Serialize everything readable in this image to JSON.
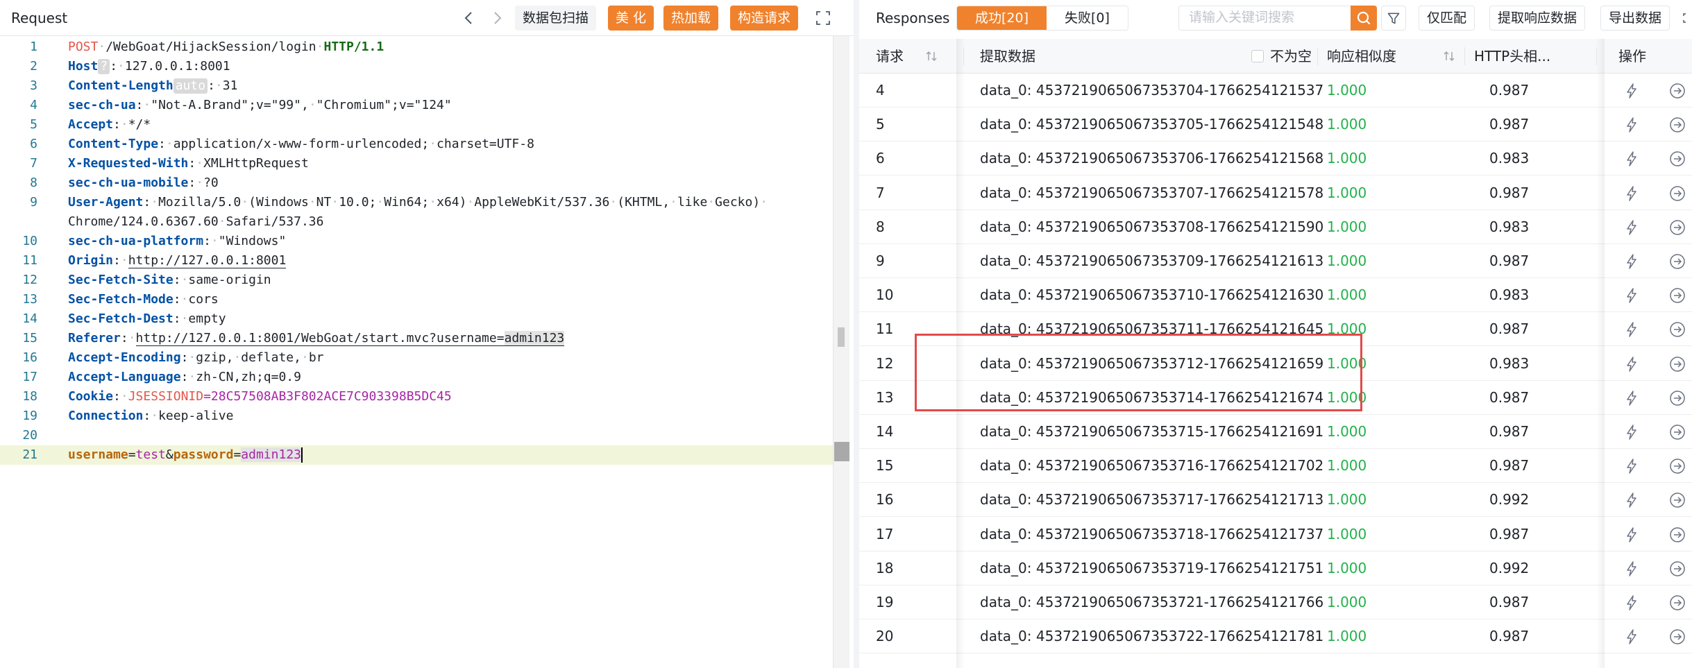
{
  "request_pane": {
    "title": "Request",
    "buttons": {
      "scan": "数据包扫描",
      "beautify": "美 化",
      "hot_load": "热加载",
      "construct": "构造请求"
    },
    "lines": [
      {
        "n": "1",
        "tokens": [
          [
            "kw-red",
            "POST"
          ],
          [
            "sep",
            "·"
          ],
          [
            "",
            "/WebGoat/HijackSession/login"
          ],
          [
            "sep",
            "·"
          ],
          [
            "kw-green",
            "HTTP/1.1"
          ]
        ]
      },
      {
        "n": "2",
        "tokens": [
          [
            "kw-blue",
            "Host"
          ],
          [
            "chip",
            "?"
          ],
          [
            "",
            ":"
          ],
          [
            "sep",
            "·"
          ],
          [
            "",
            "127.0.0.1:8001"
          ]
        ]
      },
      {
        "n": "3",
        "tokens": [
          [
            "kw-blue",
            "Content-Length"
          ],
          [
            "chip",
            "auto"
          ],
          [
            "",
            ":"
          ],
          [
            "sep",
            "·"
          ],
          [
            "",
            "31"
          ]
        ]
      },
      {
        "n": "4",
        "tokens": [
          [
            "kw-blue",
            "sec-ch-ua"
          ],
          [
            "",
            ":"
          ],
          [
            "sep",
            "·"
          ],
          [
            "",
            "\"Not-A.Brand\";v=\"99\","
          ],
          [
            "sep",
            "·"
          ],
          [
            "",
            "\"Chromium\";v=\"124\""
          ]
        ]
      },
      {
        "n": "5",
        "tokens": [
          [
            "kw-blue",
            "Accept"
          ],
          [
            "",
            ":"
          ],
          [
            "sep",
            "·"
          ],
          [
            "",
            "*/*"
          ]
        ]
      },
      {
        "n": "6",
        "tokens": [
          [
            "kw-blue",
            "Content-Type"
          ],
          [
            "",
            ":"
          ],
          [
            "sep",
            "·"
          ],
          [
            "",
            "application/x-www-form-urlencoded;"
          ],
          [
            "sep",
            "·"
          ],
          [
            "",
            "charset=UTF-8"
          ]
        ]
      },
      {
        "n": "7",
        "tokens": [
          [
            "kw-blue",
            "X-Requested-With"
          ],
          [
            "",
            ":"
          ],
          [
            "sep",
            "·"
          ],
          [
            "",
            "XMLHttpRequest"
          ]
        ]
      },
      {
        "n": "8",
        "tokens": [
          [
            "kw-blue",
            "sec-ch-ua-mobile"
          ],
          [
            "",
            ":"
          ],
          [
            "sep",
            "·"
          ],
          [
            "",
            "?0"
          ]
        ]
      },
      {
        "n": "9",
        "tokens": [
          [
            "kw-blue",
            "User-Agent"
          ],
          [
            "",
            ":"
          ],
          [
            "sep",
            "·"
          ],
          [
            "",
            "Mozilla/5.0"
          ],
          [
            "sep",
            "·"
          ],
          [
            "",
            "(Windows"
          ],
          [
            "sep",
            "·"
          ],
          [
            "",
            "NT"
          ],
          [
            "sep",
            "·"
          ],
          [
            "",
            "10.0;"
          ],
          [
            "sep",
            "·"
          ],
          [
            "",
            "Win64;"
          ],
          [
            "sep",
            "·"
          ],
          [
            "",
            "x64)"
          ],
          [
            "sep",
            "·"
          ],
          [
            "",
            "AppleWebKit/537.36"
          ],
          [
            "sep",
            "·"
          ],
          [
            "",
            "(KHTML,"
          ],
          [
            "sep",
            "·"
          ],
          [
            "",
            "like"
          ],
          [
            "sep",
            "·"
          ],
          [
            "",
            "Gecko)"
          ],
          [
            "sep",
            "·"
          ]
        ]
      },
      {
        "n": "",
        "tokens": [
          [
            "",
            "Chrome/124.0.6367.60"
          ],
          [
            "sep",
            "·"
          ],
          [
            "",
            "Safari/537.36"
          ]
        ]
      },
      {
        "n": "10",
        "tokens": [
          [
            "kw-blue",
            "sec-ch-ua-platform"
          ],
          [
            "",
            ":"
          ],
          [
            "sep",
            "·"
          ],
          [
            "",
            "\"Windows\""
          ]
        ]
      },
      {
        "n": "11",
        "tokens": [
          [
            "kw-blue",
            "Origin"
          ],
          [
            "",
            ":"
          ],
          [
            "sep",
            "·"
          ],
          [
            "uline",
            "http://127.0.0.1:8001"
          ]
        ]
      },
      {
        "n": "12",
        "tokens": [
          [
            "kw-blue",
            "Sec-Fetch-Site"
          ],
          [
            "",
            ":"
          ],
          [
            "sep",
            "·"
          ],
          [
            "",
            "same-origin"
          ]
        ]
      },
      {
        "n": "13",
        "tokens": [
          [
            "kw-blue",
            "Sec-Fetch-Mode"
          ],
          [
            "",
            ":"
          ],
          [
            "sep",
            "·"
          ],
          [
            "",
            "cors"
          ]
        ]
      },
      {
        "n": "14",
        "tokens": [
          [
            "kw-blue",
            "Sec-Fetch-Dest"
          ],
          [
            "",
            ":"
          ],
          [
            "sep",
            "·"
          ],
          [
            "",
            "empty"
          ]
        ]
      },
      {
        "n": "15",
        "tokens": [
          [
            "kw-blue",
            "Referer"
          ],
          [
            "",
            ":"
          ],
          [
            "sep",
            "·"
          ],
          [
            "uline",
            "http://127.0.0.1:8001/WebGoat/start.mvc?username="
          ],
          [
            "uline-grey",
            "admin123"
          ]
        ]
      },
      {
        "n": "16",
        "tokens": [
          [
            "kw-blue",
            "Accept-Encoding"
          ],
          [
            "",
            ":"
          ],
          [
            "sep",
            "·"
          ],
          [
            "",
            "gzip,"
          ],
          [
            "sep",
            "·"
          ],
          [
            "",
            "deflate,"
          ],
          [
            "sep",
            "·"
          ],
          [
            "",
            "br"
          ]
        ]
      },
      {
        "n": "17",
        "tokens": [
          [
            "kw-blue",
            "Accept-Language"
          ],
          [
            "",
            ":"
          ],
          [
            "sep",
            "·"
          ],
          [
            "",
            "zh-CN,zh;q=0.9"
          ]
        ]
      },
      {
        "n": "18",
        "tokens": [
          [
            "kw-blue",
            "Cookie"
          ],
          [
            "",
            ":"
          ],
          [
            "sep",
            "·"
          ],
          [
            "kw-red",
            "JSESSIONID"
          ],
          [
            "kw-purple",
            "=28C57508AB3F802ACE7C903398B5DC45"
          ]
        ]
      },
      {
        "n": "19",
        "tokens": [
          [
            "kw-blue",
            "Connection"
          ],
          [
            "",
            ":"
          ],
          [
            "sep",
            "·"
          ],
          [
            "",
            "keep-alive"
          ]
        ]
      },
      {
        "n": "20",
        "tokens": []
      },
      {
        "n": "21",
        "tokens": [
          [
            "kw-orange",
            "username"
          ],
          [
            "",
            "="
          ],
          [
            "kw-purple",
            "test"
          ],
          [
            "",
            "&"
          ],
          [
            "kw-orange",
            "password"
          ],
          [
            "",
            "="
          ],
          [
            "hl-purple",
            "admin123"
          ],
          [
            "caret",
            ""
          ]
        ]
      }
    ]
  },
  "responses_pane": {
    "title": "Responses",
    "tabs": {
      "success": "成功[20]",
      "fail": "失败[0]"
    },
    "search_placeholder": "请输入关键词搜索",
    "buttons": {
      "only_match": "仅匹配",
      "extract": "提取响应数据",
      "export": "导出数据"
    },
    "columns": {
      "req": "请求",
      "extract": "提取数据",
      "not_empty": "不为空",
      "similarity": "响应相似度",
      "header_sim": "HTTP头相...",
      "ops": "操作"
    },
    "rows": [
      {
        "req": "4",
        "data": "data_0: 4537219065067353704-1766254121537",
        "sim": "1.000",
        "hdr": "0.987"
      },
      {
        "req": "5",
        "data": "data_0: 4537219065067353705-1766254121548",
        "sim": "1.000",
        "hdr": "0.987"
      },
      {
        "req": "6",
        "data": "data_0: 4537219065067353706-1766254121568",
        "sim": "1.000",
        "hdr": "0.983"
      },
      {
        "req": "7",
        "data": "data_0: 4537219065067353707-1766254121578",
        "sim": "1.000",
        "hdr": "0.987"
      },
      {
        "req": "8",
        "data": "data_0: 4537219065067353708-1766254121590",
        "sim": "1.000",
        "hdr": "0.983"
      },
      {
        "req": "9",
        "data": "data_0: 4537219065067353709-1766254121613",
        "sim": "1.000",
        "hdr": "0.987"
      },
      {
        "req": "10",
        "data": "data_0: 4537219065067353710-1766254121630",
        "sim": "1.000",
        "hdr": "0.983"
      },
      {
        "req": "11",
        "data": "data_0: 4537219065067353711-1766254121645",
        "sim": "1.000",
        "hdr": "0.987"
      },
      {
        "req": "12",
        "data": "data_0: 4537219065067353712-1766254121659",
        "sim": "1.000",
        "hdr": "0.983"
      },
      {
        "req": "13",
        "data": "data_0: 4537219065067353714-1766254121674",
        "sim": "1.000",
        "hdr": "0.987"
      },
      {
        "req": "14",
        "data": "data_0: 4537219065067353715-1766254121691",
        "sim": "1.000",
        "hdr": "0.987"
      },
      {
        "req": "15",
        "data": "data_0: 4537219065067353716-1766254121702",
        "sim": "1.000",
        "hdr": "0.987"
      },
      {
        "req": "16",
        "data": "data_0: 4537219065067353717-1766254121713",
        "sim": "1.000",
        "hdr": "0.992"
      },
      {
        "req": "17",
        "data": "data_0: 4537219065067353718-1766254121737",
        "sim": "1.000",
        "hdr": "0.987"
      },
      {
        "req": "18",
        "data": "data_0: 4537219065067353719-1766254121751",
        "sim": "1.000",
        "hdr": "0.992"
      },
      {
        "req": "19",
        "data": "data_0: 4537219065067353721-1766254121766",
        "sim": "1.000",
        "hdr": "0.987"
      },
      {
        "req": "20",
        "data": "data_0: 4537219065067353722-1766254121781",
        "sim": "1.000",
        "hdr": "0.987"
      }
    ],
    "highlighted_rows": [
      "12",
      "13"
    ]
  },
  "icons": {
    "back": "chevron-left-icon",
    "forward": "chevron-right-icon",
    "expand": "expand-icon",
    "search": "search-icon",
    "filter": "filter-icon",
    "sort": "sort-icon",
    "lightning": "lightning-icon",
    "arrow_circle": "arrow-right-circle-icon"
  },
  "colors": {
    "accent": "#f0822d",
    "similarity_green": "#22b14c",
    "header_blue": "#0451a5",
    "highlight_box": "#e24a4a",
    "active_line": "#f1f5da"
  }
}
